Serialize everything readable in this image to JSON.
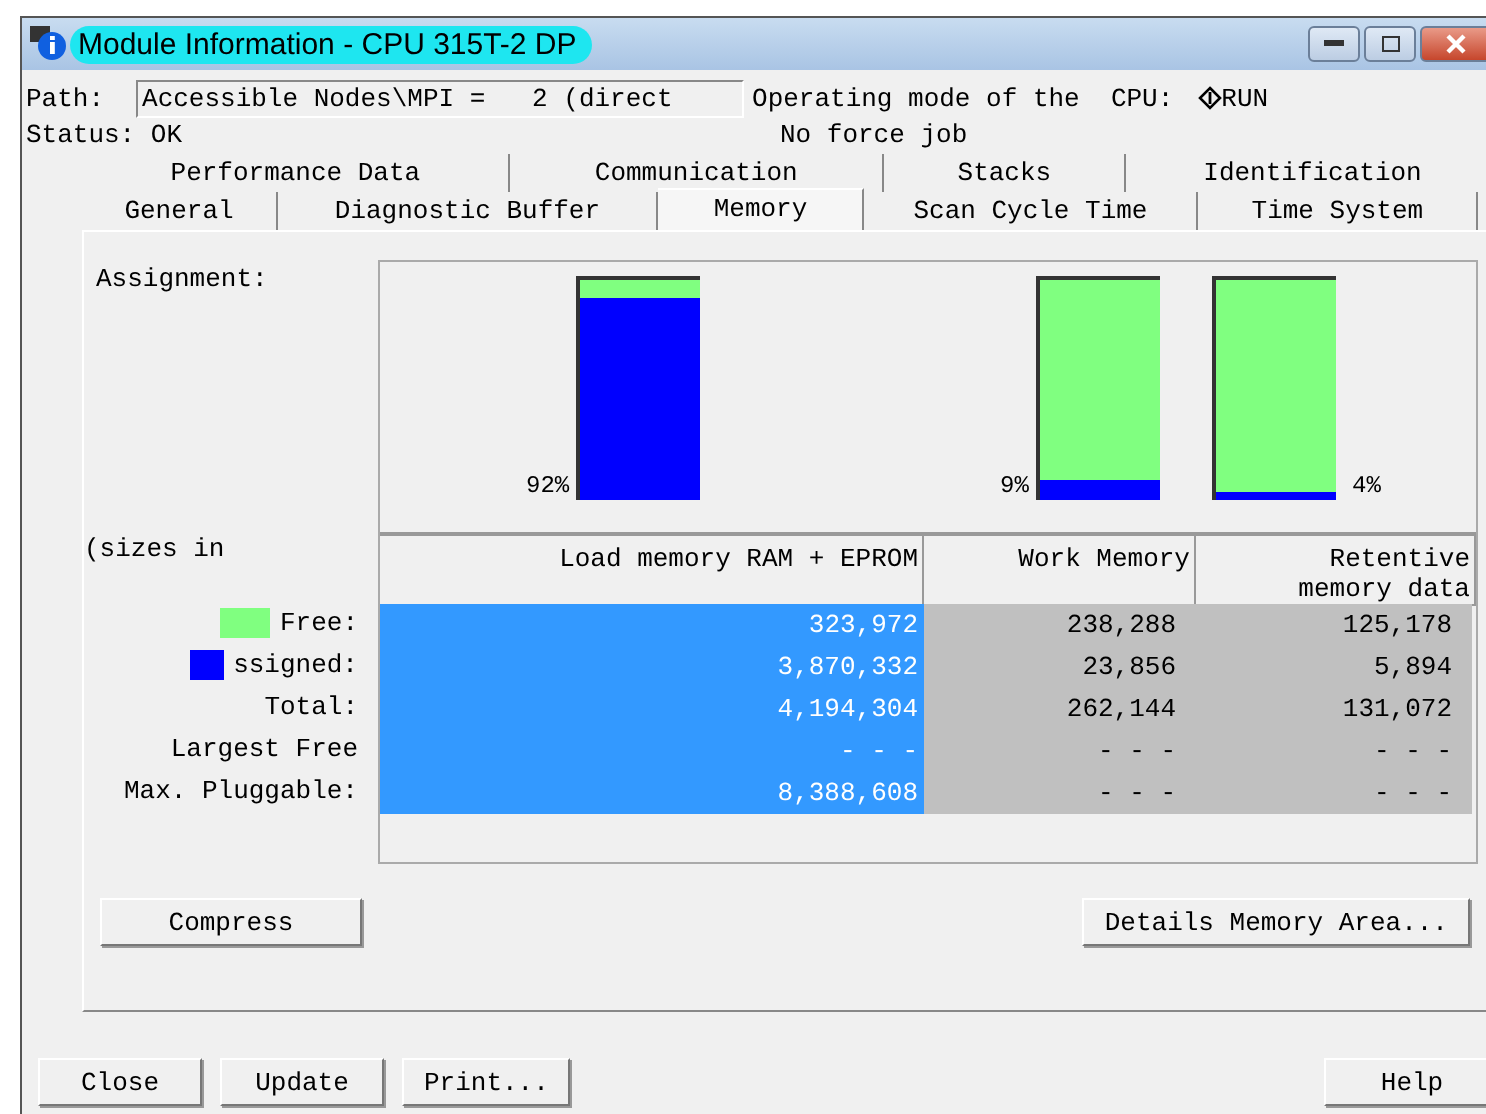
{
  "window": {
    "title": "Module Information - CPU 315T-2 DP"
  },
  "path": {
    "label": "Path:",
    "value": "Accessible Nodes\\MPI =   2 (direct"
  },
  "operating_mode": {
    "label": "Operating mode of the  CPU:",
    "value": "RUN"
  },
  "status": {
    "label": "Status: OK",
    "force": "No force job"
  },
  "tab_rows": [
    [
      {
        "label": "Performance Data",
        "selected": false
      },
      {
        "label": "Communication",
        "selected": false
      },
      {
        "label": "Stacks",
        "selected": false
      },
      {
        "label": "Identification",
        "selected": false
      }
    ],
    [
      {
        "label": "General",
        "selected": false
      },
      {
        "label": "Diagnostic Buffer",
        "selected": false
      },
      {
        "label": "Memory",
        "selected": true
      },
      {
        "label": "Scan Cycle Time",
        "selected": false
      },
      {
        "label": "Time System",
        "selected": false
      }
    ]
  ],
  "assignment_label": "Assignment:",
  "sizes_label": "(sizes in",
  "bars": [
    {
      "percent": "92%",
      "level": 0.92
    },
    {
      "percent": "9%",
      "level": 0.09
    },
    {
      "percent": "4%",
      "level": 0.04
    }
  ],
  "columns": [
    {
      "label": "Load memory RAM + EPROM",
      "selected": true
    },
    {
      "label": "Work Memory",
      "selected": false
    },
    {
      "label": "Retentive memory data",
      "selected": false
    }
  ],
  "rows": [
    {
      "label": "Free:",
      "color": "#80ff80",
      "cells": [
        "323,972",
        "238,288",
        "125,178"
      ]
    },
    {
      "label": "ssigned:",
      "color": "#0000ff",
      "cells": [
        "3,870,332",
        "23,856",
        "5,894"
      ]
    },
    {
      "label": "Total:",
      "cells": [
        "4,194,304",
        "262,144",
        "131,072"
      ]
    },
    {
      "label": "Largest Free",
      "cells": [
        "- - -",
        "- - -",
        "- - -"
      ]
    },
    {
      "label": "Max. Pluggable:",
      "cells": [
        "8,388,608",
        "- - -",
        "- - -"
      ]
    }
  ],
  "panel_buttons": [
    "Compress",
    "Details Memory Area..."
  ],
  "footer_buttons": [
    "Close",
    "Update",
    "Print..."
  ],
  "help_button": "Help"
}
